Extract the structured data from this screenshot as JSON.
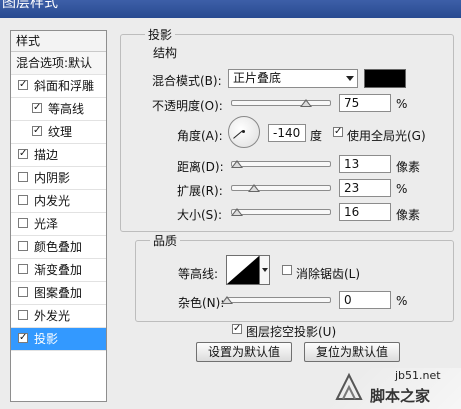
{
  "window": {
    "title": "图层样式"
  },
  "styles_panel": {
    "header": "样式",
    "blend_options": "混合选项:默认",
    "items": [
      {
        "label": "斜面和浮雕",
        "checked": true,
        "indent": false,
        "selected": false
      },
      {
        "label": "等高线",
        "checked": true,
        "indent": true,
        "selected": false
      },
      {
        "label": "纹理",
        "checked": true,
        "indent": true,
        "selected": false
      },
      {
        "label": "描边",
        "checked": true,
        "indent": false,
        "selected": false
      },
      {
        "label": "内阴影",
        "checked": false,
        "indent": false,
        "selected": false
      },
      {
        "label": "内发光",
        "checked": false,
        "indent": false,
        "selected": false
      },
      {
        "label": "光泽",
        "checked": false,
        "indent": false,
        "selected": false
      },
      {
        "label": "颜色叠加",
        "checked": false,
        "indent": false,
        "selected": false
      },
      {
        "label": "渐变叠加",
        "checked": false,
        "indent": false,
        "selected": false
      },
      {
        "label": "图案叠加",
        "checked": false,
        "indent": false,
        "selected": false
      },
      {
        "label": "外发光",
        "checked": false,
        "indent": false,
        "selected": false
      },
      {
        "label": "投影",
        "checked": true,
        "indent": false,
        "selected": true
      }
    ]
  },
  "drop_shadow": {
    "section_title": "投影",
    "structure": {
      "title": "结构",
      "blend_mode_label": "混合模式(B):",
      "blend_mode_value": "正片叠底",
      "shadow_color": "#000000",
      "opacity_label": "不透明度(O):",
      "opacity_value": "75",
      "opacity_unit": "%",
      "opacity_level": 75,
      "angle_label": "角度(A):",
      "angle_value": "-140",
      "angle_unit": "度",
      "global_light_label": "使用全局光(G)",
      "global_light_checked": true,
      "distance_label": "距离(D):",
      "distance_value": "13",
      "distance_unit": "像素",
      "distance_level": 0.06,
      "spread_label": "扩展(R):",
      "spread_value": "23",
      "spread_unit": "%",
      "spread_level": 0.23,
      "size_label": "大小(S):",
      "size_value": "16",
      "size_unit": "像素",
      "size_level": 0.06
    },
    "quality": {
      "title": "品质",
      "contour_label": "等高线:",
      "antialias_label": "消除锯齿(L)",
      "antialias_checked": false,
      "noise_label": "杂色(N):",
      "noise_value": "0",
      "noise_unit": "%",
      "noise_level": 0
    },
    "knockout_label": "图层挖空投影(U)",
    "knockout_checked": true,
    "make_default_label": "设置为默认值",
    "reset_default_label": "复位为默认值"
  },
  "watermark": {
    "url": "jb51.net",
    "text": "脚本之家"
  }
}
